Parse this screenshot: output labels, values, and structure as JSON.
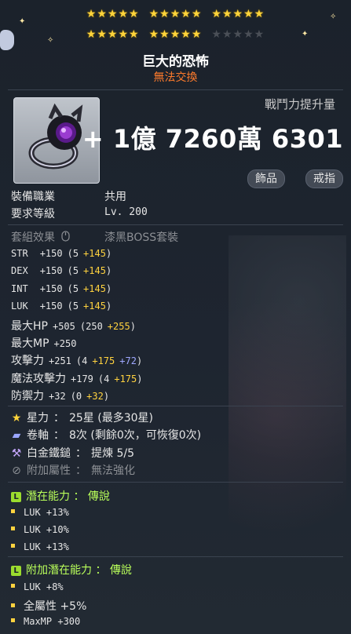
{
  "star_force": {
    "groups_filled": [
      5,
      5,
      5,
      5,
      5,
      0
    ],
    "note": ""
  },
  "item": {
    "name": "巨大的恐怖",
    "trade_status": "無法交換",
    "icon": "dark-ring-icon",
    "combat_power_label": "戰鬥力提升量",
    "combat_power_value": "+ 1億 7260萬 6301",
    "tags": [
      "飾品",
      "戒指"
    ]
  },
  "requirements": {
    "job_label": "裝備職業",
    "job_value": "共用",
    "level_label": "要求等級",
    "level_value": "Lv. 200"
  },
  "set": {
    "label": "套組效果",
    "icon": "mouse-icon",
    "value": "漆黑BOSS套裝"
  },
  "stats": [
    {
      "name": "STR",
      "total": "+150",
      "base": "(5",
      "bonus": "+145",
      "extra": "",
      "close": ")"
    },
    {
      "name": "DEX",
      "total": "+150",
      "base": "(5",
      "bonus": "+145",
      "extra": "",
      "close": ")"
    },
    {
      "name": "INT",
      "total": "+150",
      "base": "(5",
      "bonus": "+145",
      "extra": "",
      "close": ")"
    },
    {
      "name": "LUK",
      "total": "+150",
      "base": "(5",
      "bonus": "+145",
      "extra": "",
      "close": ")"
    },
    {
      "name": "最大HP",
      "total": "+505",
      "base": "(250",
      "bonus": "+255",
      "extra": "",
      "close": ")"
    },
    {
      "name": "最大MP",
      "total": "+250",
      "base": "",
      "bonus": "",
      "extra": "",
      "close": ""
    },
    {
      "name": "攻擊力",
      "total": "+251",
      "base": "(4",
      "bonus": "+175",
      "extra": "+72",
      "close": ")"
    },
    {
      "name": "魔法攻擊力",
      "total": "+179",
      "base": "(4",
      "bonus": "+175",
      "extra": "",
      "close": ")"
    },
    {
      "name": "防禦力",
      "total": "+32",
      "base": "(0",
      "bonus": "+32",
      "extra": "",
      "close": ")"
    }
  ],
  "enhancements": [
    {
      "icon": "star-icon",
      "label": "星力",
      "sep": "：",
      "value": "25星 (最多30星)"
    },
    {
      "icon": "scroll-icon",
      "label": "卷軸",
      "sep": "：",
      "value": "8次 (剩餘0次，可恢復0次)"
    },
    {
      "icon": "hammer-icon",
      "label": "白金鐵鎚",
      "sep": "：",
      "value": "提煉 5/5"
    },
    {
      "icon": "disabled-icon",
      "label": "附加屬性",
      "sep": "：",
      "value": "無法強化"
    }
  ],
  "potential": {
    "badge": "L",
    "label": "潛在能力",
    "sep": "：",
    "grade": "傳說",
    "lines": [
      "LUK +13%",
      "LUK +10%",
      "LUK +13%"
    ]
  },
  "additional_potential": {
    "badge": "L",
    "label": "附加潛在能力",
    "sep": "：",
    "grade": "傳說",
    "lines": [
      "LUK +8%",
      "全屬性 +5%",
      "MaxMP +300"
    ]
  },
  "colors": {
    "star_on": "#ffd43b",
    "bonus": "#ffd23f",
    "extra": "#9fa8ff",
    "legendary": "#b9ff5a",
    "untradeable": "#ff7b2b"
  }
}
